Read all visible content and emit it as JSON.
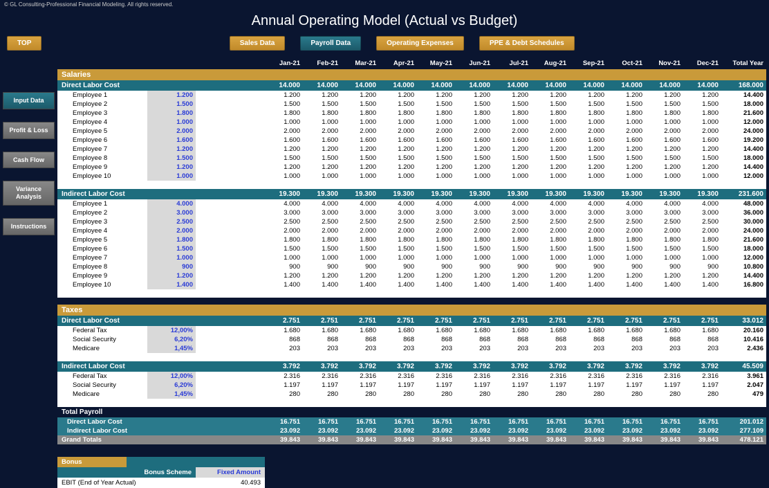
{
  "copyright": "© GL Consulting-Professional Financial Modeling. All rights reserved.",
  "title": "Annual Operating Model (Actual vs Budget)",
  "top_button": "TOP",
  "nav": {
    "sales": "Sales Data",
    "payroll": "Payroll Data",
    "opex": "Operating Expenses",
    "ppe": "PPE & Debt Schedules"
  },
  "side": {
    "input": "Input Data",
    "pl": "Profit & Loss",
    "cash": "Cash Flow",
    "var": "Variance Analysis",
    "instr": "Instructions"
  },
  "months": [
    "Jan-21",
    "Feb-21",
    "Mar-21",
    "Apr-21",
    "May-21",
    "Jun-21",
    "Jul-21",
    "Aug-21",
    "Sep-21",
    "Oct-21",
    "Nov-21",
    "Dec-21"
  ],
  "total_label": "Total Year",
  "sections": {
    "salaries": "Salaries",
    "taxes": "Taxes",
    "total_payroll": "Total Payroll",
    "direct_labor": "Direct Labor Cost",
    "indirect_labor": "Indirect Labor Cost",
    "grand_totals": "Grand Totals",
    "bonus": "Bonus",
    "bonus_scheme": "Bonus Scheme",
    "fixed_amount": "Fixed Amount",
    "ebit": "EBIT (End of Year Actual)",
    "ebit_val": "40.493"
  },
  "direct_header": {
    "monthly": "14.000",
    "total": "168.000"
  },
  "direct": [
    {
      "name": "Employee 1",
      "rate": "1.200",
      "m": "1.200",
      "t": "14.400"
    },
    {
      "name": "Employee 2",
      "rate": "1.500",
      "m": "1.500",
      "t": "18.000"
    },
    {
      "name": "Employee 3",
      "rate": "1.800",
      "m": "1.800",
      "t": "21.600"
    },
    {
      "name": "Employee 4",
      "rate": "1.000",
      "m": "1.000",
      "t": "12.000"
    },
    {
      "name": "Employee 5",
      "rate": "2.000",
      "m": "2.000",
      "t": "24.000"
    },
    {
      "name": "Employee 6",
      "rate": "1.600",
      "m": "1.600",
      "t": "19.200"
    },
    {
      "name": "Employee 7",
      "rate": "1.200",
      "m": "1.200",
      "t": "14.400"
    },
    {
      "name": "Employee 8",
      "rate": "1.500",
      "m": "1.500",
      "t": "18.000"
    },
    {
      "name": "Employee 9",
      "rate": "1.200",
      "m": "1.200",
      "t": "14.400"
    },
    {
      "name": "Employee 10",
      "rate": "1.000",
      "m": "1.000",
      "t": "12.000"
    }
  ],
  "indirect_header": {
    "monthly": "19.300",
    "total": "231.600"
  },
  "indirect": [
    {
      "name": "Employee 1",
      "rate": "4.000",
      "m": "4.000",
      "t": "48.000"
    },
    {
      "name": "Employee 2",
      "rate": "3.000",
      "m": "3.000",
      "t": "36.000"
    },
    {
      "name": "Employee 3",
      "rate": "2.500",
      "m": "2.500",
      "t": "30.000"
    },
    {
      "name": "Employee 4",
      "rate": "2.000",
      "m": "2.000",
      "t": "24.000"
    },
    {
      "name": "Employee 5",
      "rate": "1.800",
      "m": "1.800",
      "t": "21.600"
    },
    {
      "name": "Employee 6",
      "rate": "1.500",
      "m": "1.500",
      "t": "18.000"
    },
    {
      "name": "Employee 7",
      "rate": "1.000",
      "m": "1.000",
      "t": "12.000"
    },
    {
      "name": "Employee 8",
      "rate": "900",
      "m": "900",
      "t": "10.800"
    },
    {
      "name": "Employee 9",
      "rate": "1.200",
      "m": "1.200",
      "t": "14.400"
    },
    {
      "name": "Employee 10",
      "rate": "1.400",
      "m": "1.400",
      "t": "16.800"
    }
  ],
  "tax_direct_header": {
    "monthly": "2.751",
    "total": "33.012"
  },
  "tax_direct": [
    {
      "name": "Federal Tax",
      "rate": "12,00%",
      "m": "1.680",
      "t": "20.160"
    },
    {
      "name": "Social Security",
      "rate": "6,20%",
      "m": "868",
      "t": "10.416"
    },
    {
      "name": "Medicare",
      "rate": "1,45%",
      "m": "203",
      "t": "2.436"
    }
  ],
  "tax_indirect_header": {
    "monthly": "3.792",
    "total": "45.509"
  },
  "tax_indirect": [
    {
      "name": "Federal Tax",
      "rate": "12,00%",
      "m": "2.316",
      "t": "3.961"
    },
    {
      "name": "Social Security",
      "rate": "6,20%",
      "m": "1.197",
      "t": "2.047"
    },
    {
      "name": "Medicare",
      "rate": "1,45%",
      "m": "280",
      "t": "479"
    }
  ],
  "summary": {
    "direct": {
      "m": "16.751",
      "t": "201.012"
    },
    "indirect": {
      "m": "23.092",
      "t": "277.109"
    },
    "grand": {
      "m": "39.843",
      "t": "478.121"
    }
  }
}
